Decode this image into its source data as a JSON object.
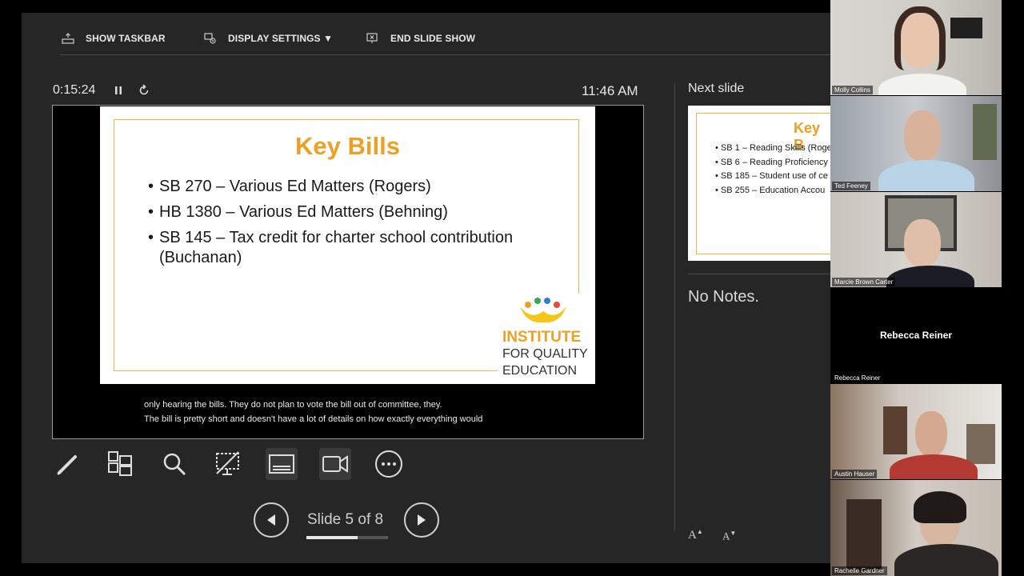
{
  "toolbar": {
    "show_taskbar": "SHOW TASKBAR",
    "display_settings": "DISPLAY SETTINGS ▼",
    "end_slide_show": "END SLIDE SHOW"
  },
  "timer": {
    "elapsed": "0:15:24",
    "clock": "11:46 AM"
  },
  "current_slide": {
    "title": "Key Bills",
    "bullets": [
      "SB 270 – Various Ed Matters (Rogers)",
      "HB 1380 – Various Ed Matters (Behning)",
      "SB 145 – Tax credit for charter school contribution (Buchanan)"
    ],
    "logo": {
      "line1": "INSTITUTE",
      "line2": "FOR QUALITY",
      "line3": "EDUCATION"
    }
  },
  "captions": [
    "only hearing the bills. They do not plan to vote the bill out of committee, they.",
    "The bill is pretty short and doesn't have a lot of details on how exactly everything would"
  ],
  "navigation": {
    "slide_counter": "Slide 5 of 8",
    "progress": 0.625
  },
  "next_slide": {
    "label": "Next slide",
    "title_partial": "Key B",
    "bullets": [
      "SB 1 – Reading Skills (Roge",
      "SB 6 – Reading Proficiency",
      "SB 185 – Student use of ce",
      "SB 255 – Education Accou"
    ]
  },
  "notes": {
    "text": "No Notes."
  },
  "font_controls": {
    "increase": "A",
    "decrease": "A"
  },
  "participants": [
    {
      "name": "Molly Collins"
    },
    {
      "name": "Ted Feeney"
    },
    {
      "name": "Marcie Brown Carter"
    },
    {
      "name": "Rebecca Reiner",
      "center_name": "Rebecca Reiner"
    },
    {
      "name": "Austin Hauser"
    },
    {
      "name": "Rachelle Gardner"
    }
  ],
  "colors": {
    "accent": "#f0a020",
    "panel": "#262626",
    "background": "#000000"
  }
}
